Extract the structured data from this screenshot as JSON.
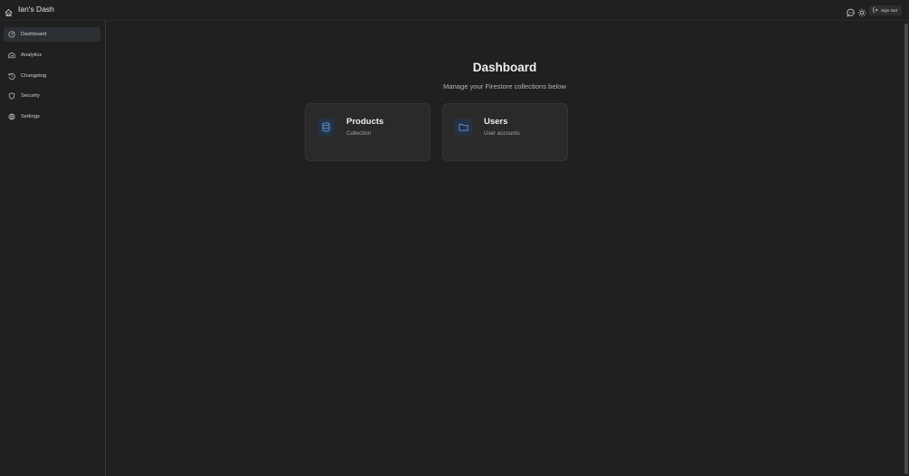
{
  "header": {
    "title": "Ian's Dash",
    "home_icon": "home-icon",
    "chat_icon": "message-icon",
    "theme_icon": "sun-icon",
    "signout_label": "Sign Out",
    "signout_icon": "logout-icon"
  },
  "sidebar": {
    "items": [
      {
        "label": "Dashboard",
        "icon": "dashboard-icon",
        "active": true
      },
      {
        "label": "Analytics",
        "icon": "analytics-icon",
        "active": false
      },
      {
        "label": "Changelog",
        "icon": "history-icon",
        "active": false
      },
      {
        "label": "Security",
        "icon": "shield-icon",
        "active": false
      },
      {
        "label": "Settings",
        "icon": "gear-icon",
        "active": false
      }
    ]
  },
  "main": {
    "title": "Dashboard",
    "subtitle": "Manage your Firestore collections below",
    "cards": [
      {
        "title": "Products",
        "subtitle": "Collection",
        "icon": "database-icon"
      },
      {
        "title": "Users",
        "subtitle": "User accounts",
        "icon": "folder-icon"
      }
    ]
  },
  "colors": {
    "background": "#202020",
    "card": "#2a2a2a",
    "accent": "#4a8fd8",
    "active_item": "#2c2f33"
  }
}
